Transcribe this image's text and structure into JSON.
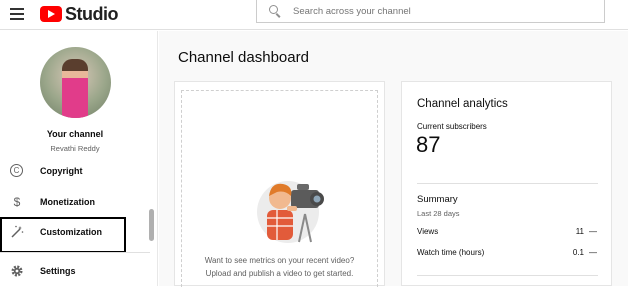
{
  "header": {
    "logo_text": "Studio",
    "search_placeholder": "Search across your channel"
  },
  "sidebar": {
    "channel_title": "Your channel",
    "channel_name": "Revathi Reddy",
    "items": [
      {
        "label": "Copyright",
        "icon": "copyright-icon"
      },
      {
        "label": "Monetization",
        "icon": "dollar-icon"
      },
      {
        "label": "Customization",
        "icon": "magic-wand-icon"
      },
      {
        "label": "Settings",
        "icon": "gear-icon"
      }
    ]
  },
  "main": {
    "page_title": "Channel dashboard",
    "upload_card": {
      "line1": "Want to see metrics on your recent video?",
      "line2": "Upload and publish a video to get started."
    },
    "analytics": {
      "title": "Channel analytics",
      "subscribers_label": "Current subscribers",
      "subscribers_count": "87",
      "summary_title": "Summary",
      "summary_period": "Last 28 days",
      "rows": [
        {
          "label": "Views",
          "value": "11",
          "trend": "—"
        },
        {
          "label": "Watch time (hours)",
          "value": "0.1",
          "trend": "—"
        }
      ]
    }
  },
  "colors": {
    "brand_red": "#ff0000",
    "highlight_border": "#000000"
  }
}
